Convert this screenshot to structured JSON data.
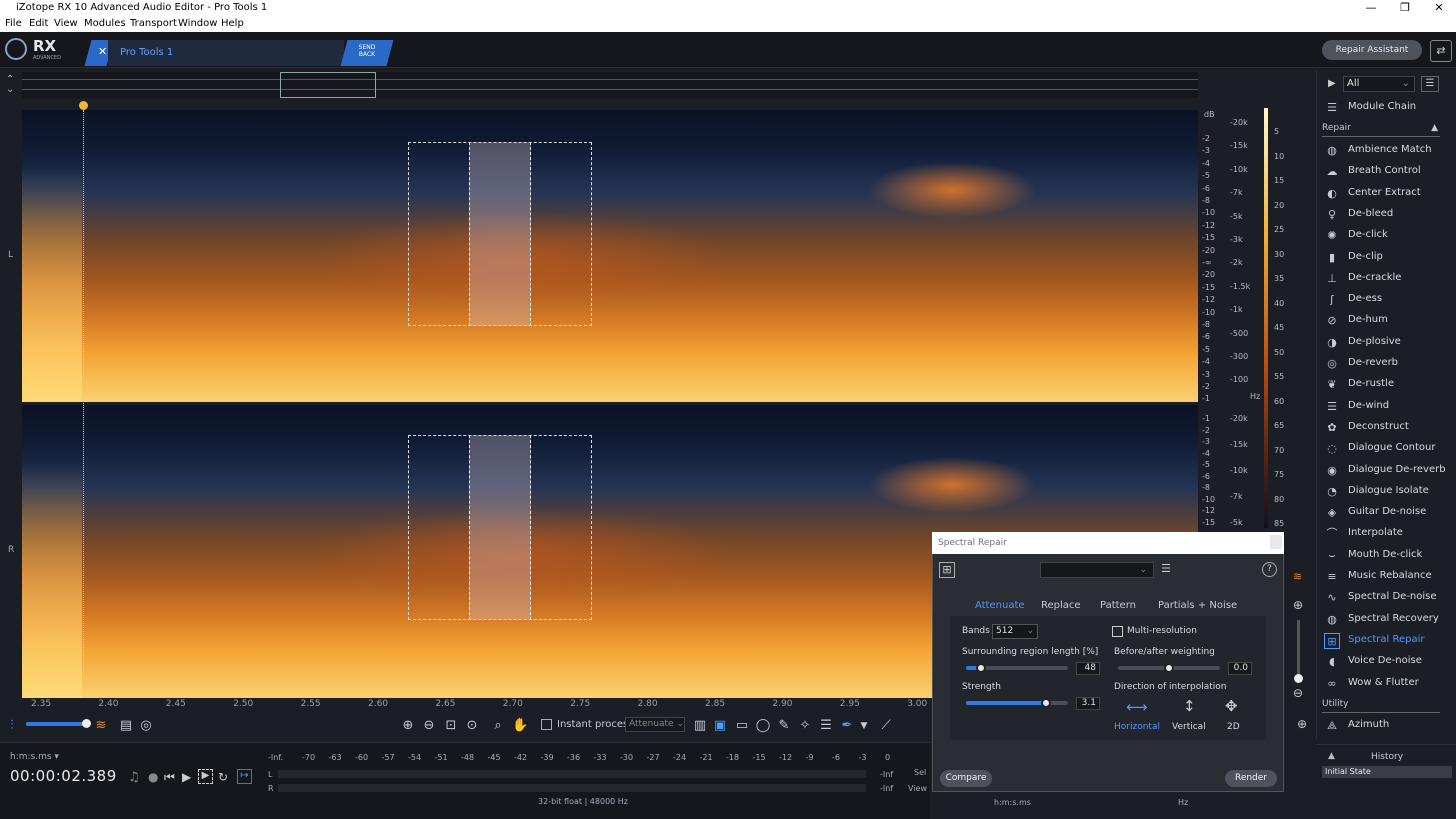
{
  "window": {
    "title": "iZotope RX 10 Advanced Audio Editor - Pro Tools 1",
    "min": "—",
    "max": "❐",
    "close": "✕"
  },
  "menu": [
    "File",
    "Edit",
    "View",
    "Modules",
    "Transport",
    "Window",
    "Help"
  ],
  "appbar": {
    "logo": "RX",
    "logo_sub": "ADVANCED",
    "tab_label": "Pro Tools 1",
    "send_back": "SEND BACK",
    "repair_assistant": "Repair Assistant"
  },
  "channels": {
    "left": "L",
    "right": "R"
  },
  "scale_db_units": "dB",
  "scale_db": [
    "-2",
    "-3",
    "-4",
    "-5",
    "-6",
    "-8",
    "-10",
    "-12",
    "-15",
    "-20",
    "-∞",
    "-20",
    "-15",
    "-12",
    "-10",
    "-8",
    "-6",
    "-5",
    "-4",
    "-3",
    "-2",
    "-1"
  ],
  "scale_hz_units": "Hz",
  "scale_hz": [
    "-20k",
    "-15k",
    "-10k",
    "-7k",
    "-5k",
    "-3k",
    "-2k",
    "-1.5k",
    "-1k",
    "-500",
    "-300",
    "-100"
  ],
  "scale_db2": [
    "-1",
    "-2",
    "-3",
    "-4",
    "-5",
    "-6",
    "-8",
    "-10",
    "-12",
    "-15"
  ],
  "scale_hz2": [
    "-20k",
    "-15k",
    "-10k",
    "-7k",
    "-5k"
  ],
  "scale_n": [
    "5",
    "10",
    "15",
    "20",
    "25",
    "30",
    "35",
    "40",
    "45",
    "50",
    "55",
    "60",
    "65",
    "70",
    "75",
    "80",
    "85"
  ],
  "timeline": [
    "2.35",
    "2.40",
    "2.45",
    "2.50",
    "2.55",
    "2.60",
    "2.65",
    "2.70",
    "2.75",
    "2.80",
    "2.85",
    "2.90",
    "2.95",
    "3.00"
  ],
  "toolbar": {
    "instant_process": "Instant process",
    "mode": "Attenuate"
  },
  "status": {
    "format": "h:m:s.ms",
    "timecode": "00:00:02.389",
    "bitinfo": "32-bit float | 48000 Hz",
    "sel_label": "Sel",
    "view_label": "View",
    "col_hms": "h:m:s.ms",
    "col_hz": "Hz"
  },
  "meter_scale": [
    "-Inf.",
    "-70",
    "-63",
    "-60",
    "-57",
    "-54",
    "-51",
    "-48",
    "-45",
    "-42",
    "-39",
    "-36",
    "-33",
    "-30",
    "-27",
    "-24",
    "-21",
    "-18",
    "-15",
    "-12",
    "-9",
    "-6",
    "-3",
    "0"
  ],
  "meter": {
    "l": "L",
    "r": "R",
    "inf_l": "-Inf",
    "inf_r": "-Inf"
  },
  "sidebar": {
    "filter": "All",
    "module_chain": "Module Chain",
    "repair_header": "Repair",
    "utility_header": "Utility",
    "modules": [
      {
        "label": "Ambience Match",
        "icon": "ambience-icon"
      },
      {
        "label": "Breath Control",
        "icon": "breath-icon"
      },
      {
        "label": "Center Extract",
        "icon": "center-icon"
      },
      {
        "label": "De-bleed",
        "icon": "debleed-icon"
      },
      {
        "label": "De-click",
        "icon": "declick-icon"
      },
      {
        "label": "De-clip",
        "icon": "declip-icon"
      },
      {
        "label": "De-crackle",
        "icon": "decrackle-icon"
      },
      {
        "label": "De-ess",
        "icon": "deess-icon"
      },
      {
        "label": "De-hum",
        "icon": "dehum-icon"
      },
      {
        "label": "De-plosive",
        "icon": "deplosive-icon"
      },
      {
        "label": "De-reverb",
        "icon": "dereverb-icon"
      },
      {
        "label": "De-rustle",
        "icon": "derustle-icon"
      },
      {
        "label": "De-wind",
        "icon": "dewind-icon"
      },
      {
        "label": "Deconstruct",
        "icon": "deconstruct-icon"
      },
      {
        "label": "Dialogue Contour",
        "icon": "contour-icon"
      },
      {
        "label": "Dialogue De-reverb",
        "icon": "dlg-dereverb-icon"
      },
      {
        "label": "Dialogue Isolate",
        "icon": "isolate-icon"
      },
      {
        "label": "Guitar De-noise",
        "icon": "guitar-icon"
      },
      {
        "label": "Interpolate",
        "icon": "interpolate-icon"
      },
      {
        "label": "Mouth De-click",
        "icon": "mouth-icon"
      },
      {
        "label": "Music Rebalance",
        "icon": "rebalance-icon"
      },
      {
        "label": "Spectral De-noise",
        "icon": "spectral-denoise-icon"
      },
      {
        "label": "Spectral Recovery",
        "icon": "recovery-icon"
      },
      {
        "label": "Spectral Repair",
        "icon": "spectral-repair-icon"
      },
      {
        "label": "Voice De-noise",
        "icon": "voice-icon"
      },
      {
        "label": "Wow & Flutter",
        "icon": "wow-icon"
      }
    ],
    "utility": [
      {
        "label": "Azimuth",
        "icon": "azimuth-icon"
      }
    ]
  },
  "history": {
    "title": "History",
    "items": [
      "Initial State"
    ]
  },
  "dialog": {
    "title": "Spectral Repair",
    "tabs": [
      "Attenuate",
      "Replace",
      "Pattern",
      "Partials + Noise"
    ],
    "bands_label": "Bands",
    "bands_value": "512",
    "multires_label": "Multi-resolution",
    "surround_label": "Surrounding region length [%]",
    "surround_value": "48",
    "surround_fill": 0.15,
    "weighting_label": "Before/after weighting",
    "weighting_value": "0.0",
    "weighting_fill": 0.5,
    "strength_label": "Strength",
    "strength_value": "3.1",
    "strength_fill": 0.78,
    "direction_label": "Direction of interpolation",
    "dir_h": "Horizontal",
    "dir_v": "Vertical",
    "dir_2d": "2D",
    "compare": "Compare",
    "render": "Render"
  },
  "colors": {
    "accent": "#2f7be6",
    "playhead": "#f3b630"
  }
}
